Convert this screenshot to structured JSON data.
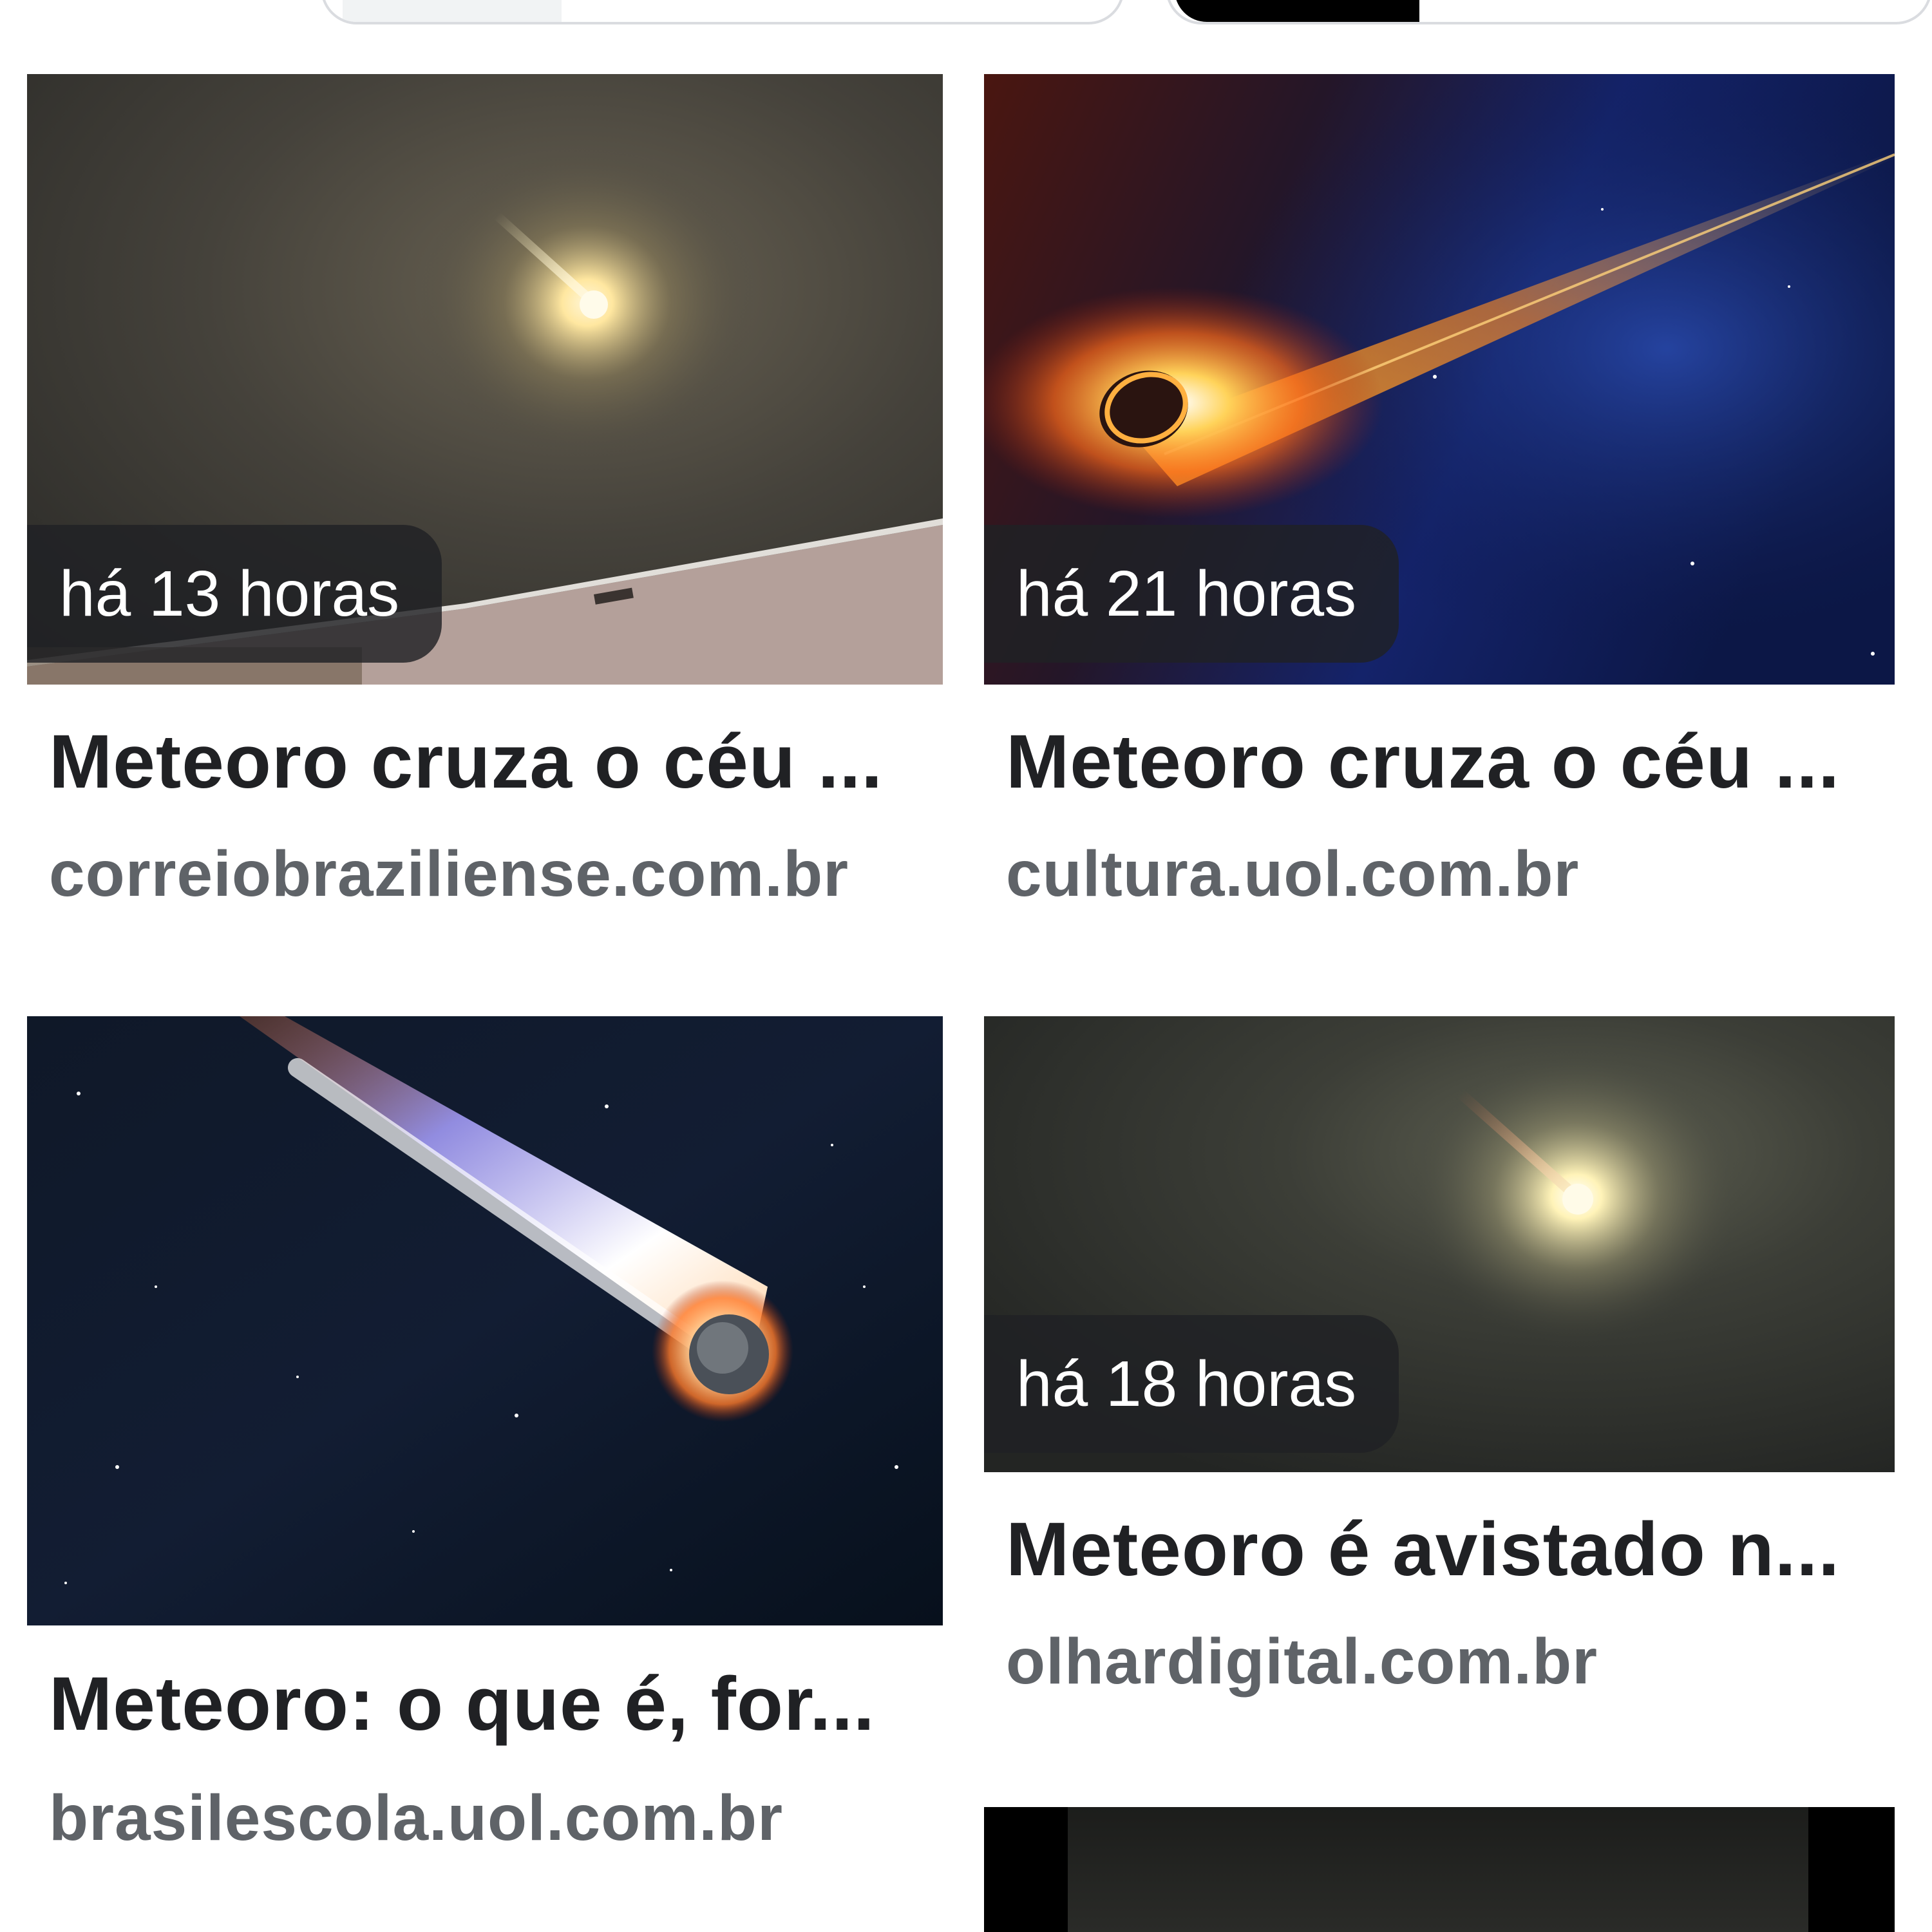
{
  "results": [
    {
      "time": "há 13 horas",
      "title": "Meteoro cruza o céu ...",
      "source": "correiobraziliense.com.br",
      "image": "meteor-night-sky-building-photo"
    },
    {
      "time": "há 21 horas",
      "title": "Meteoro cruza o céu ...",
      "source": "cultura.uol.com.br",
      "image": "meteor-illustration-blue-space"
    },
    {
      "title": "Meteoro: o que é, for...",
      "source": "brasilescola.uol.com.br",
      "image": "comet-burning-starfield"
    },
    {
      "time": "há 18 horas",
      "title": "Meteoro é avistado n...",
      "source": "olhardigital.com.br",
      "image": "meteor-glow-dark-sky"
    },
    {
      "image": "dark-video-thumbnail"
    }
  ],
  "colors": {
    "title": "#202124",
    "source": "#5f6368",
    "badge_bg": "#202124"
  }
}
